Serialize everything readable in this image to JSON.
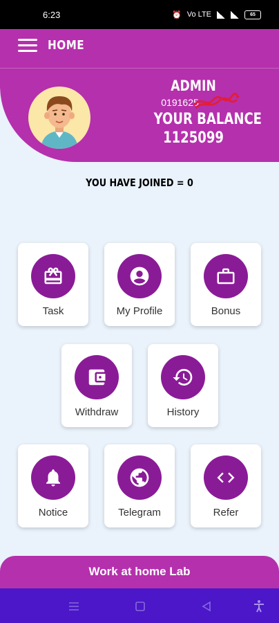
{
  "status_bar": {
    "time": "6:23",
    "network": "Vo LTE",
    "battery": "65"
  },
  "header": {
    "title": "HOME",
    "user_name": "ADMIN",
    "phone": "0191625",
    "balance_label": "YOUR BALANCE",
    "balance_value": "1125099"
  },
  "joined_text": "YOU HAVE JOINED = 0",
  "menu": {
    "task": "Task",
    "profile": "My Profile",
    "bonus": "Bonus",
    "withdraw": "Withdraw",
    "history": "History",
    "notice": "Notice",
    "telegram": "Telegram",
    "refer": "Refer"
  },
  "footer_text": "Work at home Lab",
  "colors": {
    "primary": "#b530ad",
    "icon_circle": "#8a1b97",
    "nav_bar": "#4b17c9",
    "background": "#eaf2fb"
  },
  "icons": [
    "menu-icon",
    "gift-icon",
    "account-circle-icon",
    "briefcase-icon",
    "wallet-icon",
    "history-icon",
    "bell-icon",
    "globe-icon",
    "code-icon"
  ]
}
